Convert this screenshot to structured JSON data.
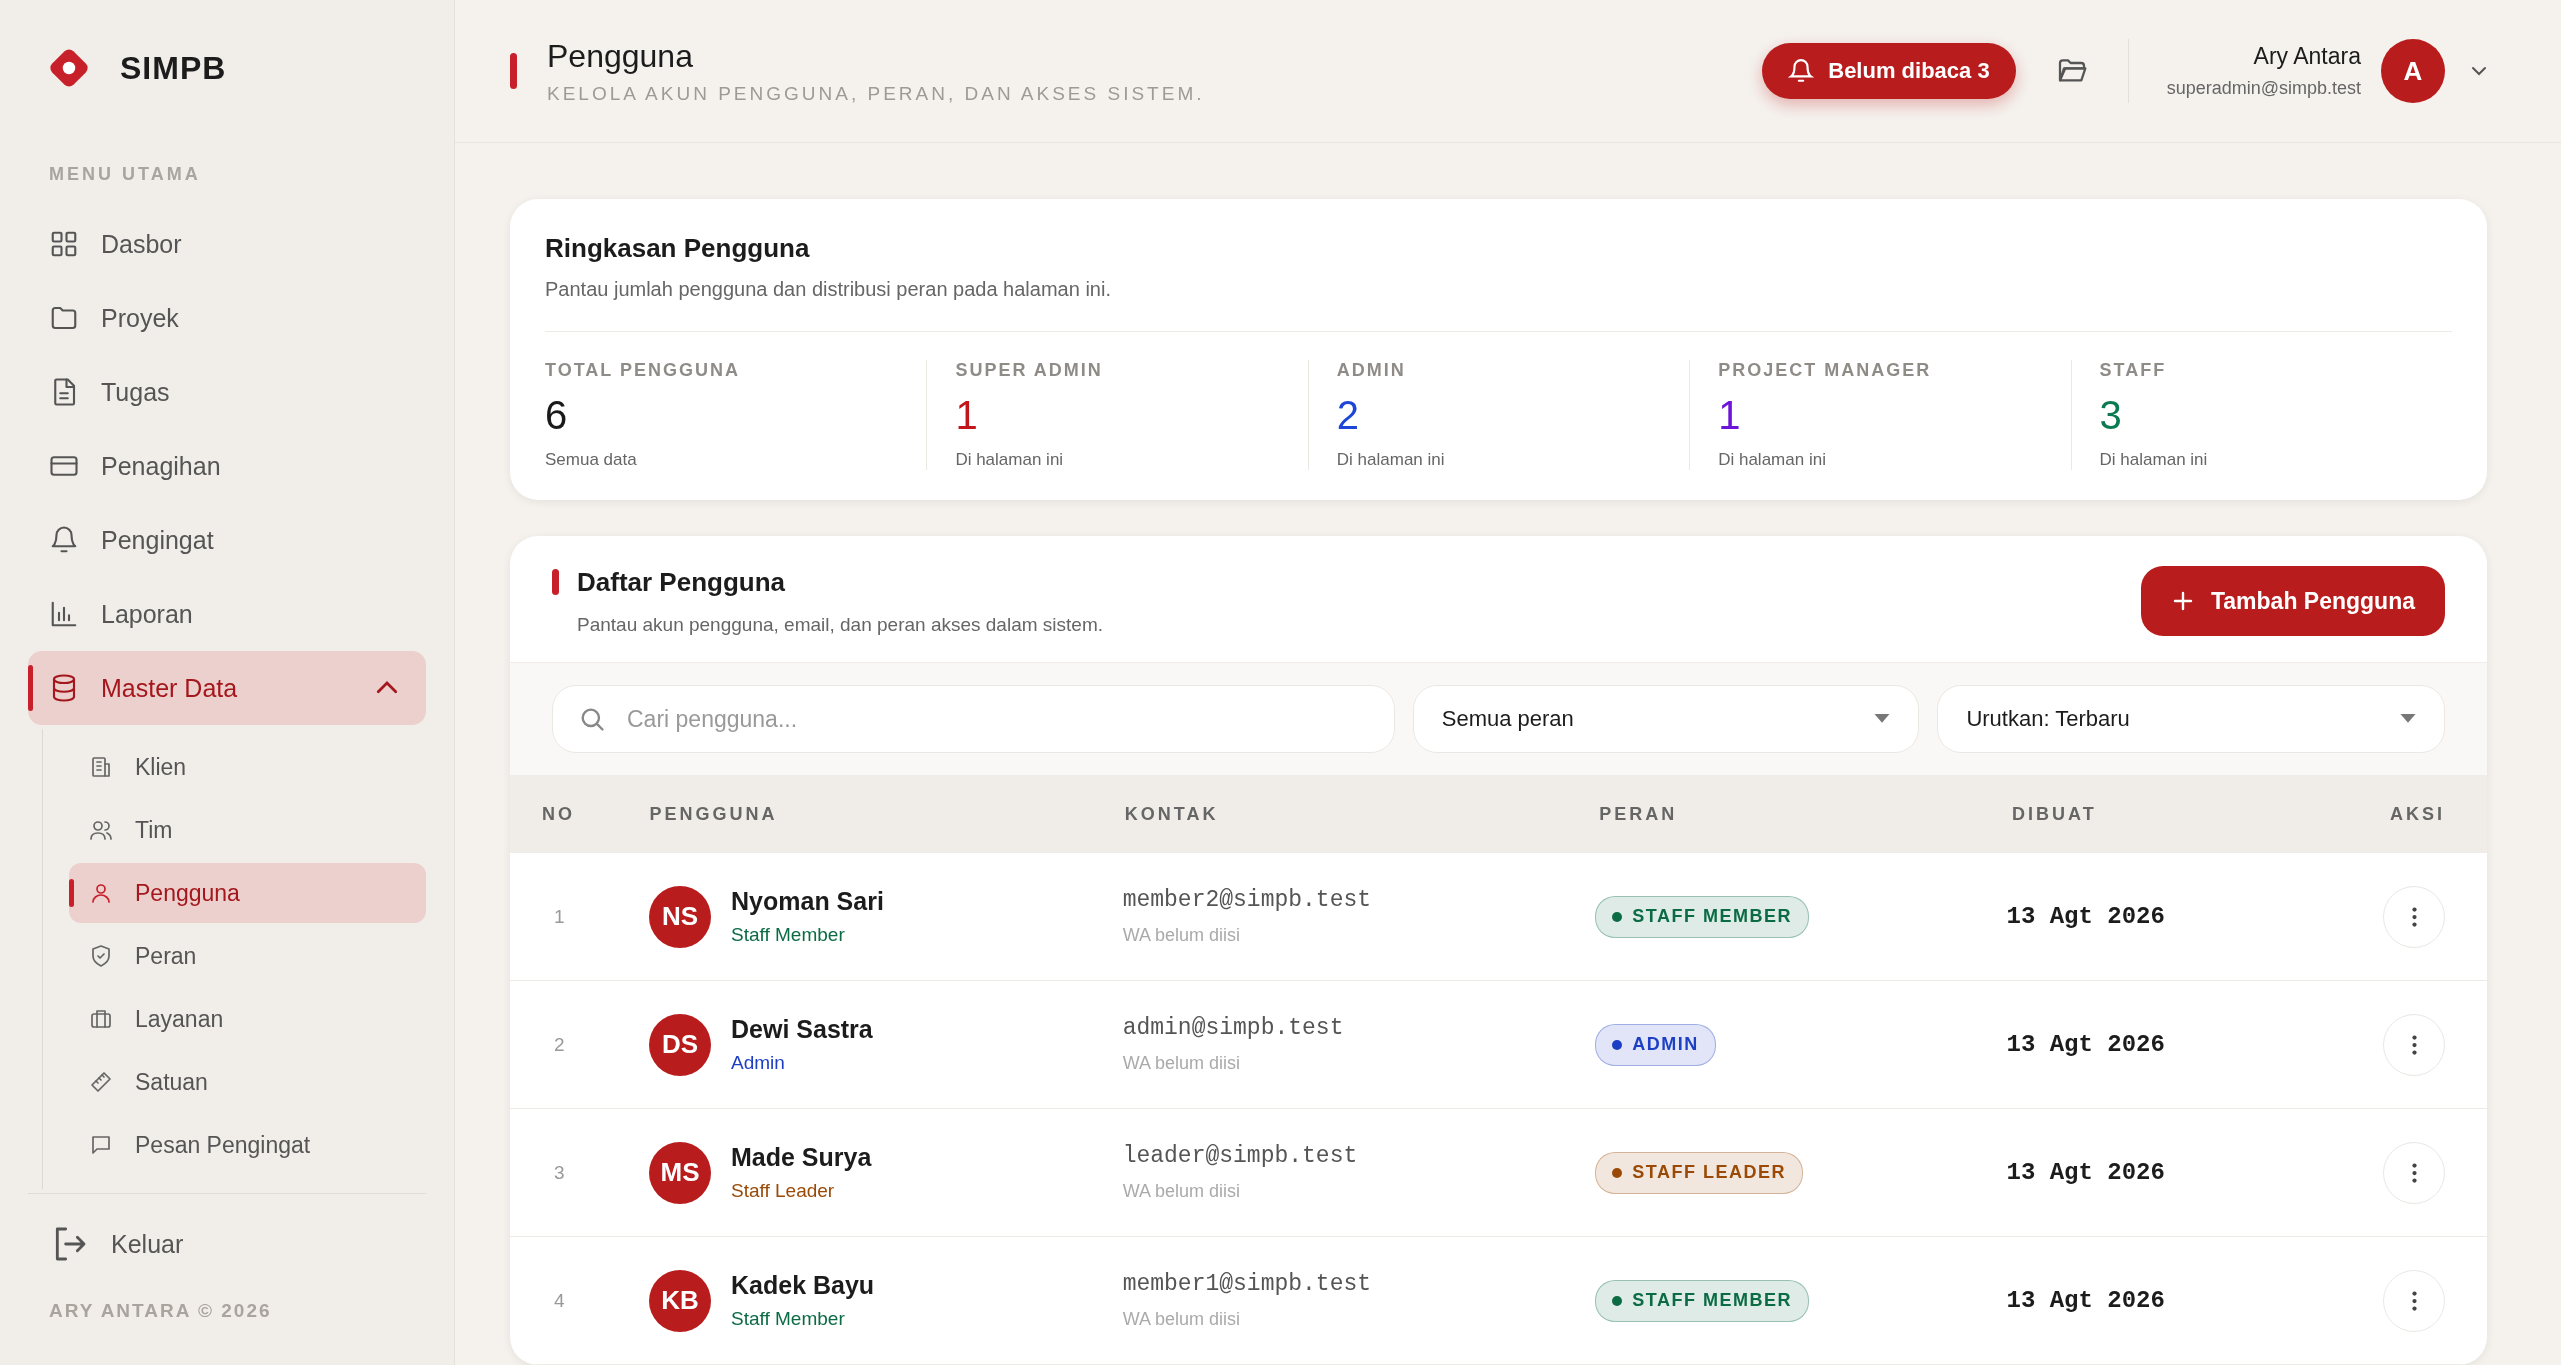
{
  "brand": {
    "name": "SIMPB"
  },
  "sidebar": {
    "section": "MENU UTAMA",
    "items": [
      {
        "label": "Dasbor",
        "selected": false
      },
      {
        "label": "Proyek",
        "selected": false
      },
      {
        "label": "Tugas",
        "selected": false
      },
      {
        "label": "Penagihan",
        "selected": false
      },
      {
        "label": "Pengingat",
        "selected": false
      },
      {
        "label": "Laporan",
        "selected": false
      },
      {
        "label": "Master Data",
        "selected": true,
        "expanded": true,
        "children": [
          {
            "label": "Klien",
            "selected": false
          },
          {
            "label": "Tim",
            "selected": false
          },
          {
            "label": "Pengguna",
            "selected": true
          },
          {
            "label": "Peran",
            "selected": false
          },
          {
            "label": "Layanan",
            "selected": false
          },
          {
            "label": "Satuan",
            "selected": false
          },
          {
            "label": "Pesan Pengingat",
            "selected": false
          }
        ]
      }
    ],
    "logout": "Keluar",
    "footer": "ARY ANTARA © 2026"
  },
  "header": {
    "title": "Pengguna",
    "subtitle": "KELOLA AKUN PENGGUNA, PERAN, DAN AKSES SISTEM.",
    "notification": "Belum dibaca 3",
    "user_name": "Ary Antara",
    "user_email": "superadmin@simpb.test",
    "avatar": "A"
  },
  "summary": {
    "title": "Ringkasan Pengguna",
    "description": "Pantau jumlah pengguna dan distribusi peran pada halaman ini.",
    "stats": [
      {
        "label": "TOTAL PENGGUNA",
        "value": "6",
        "note": "Semua data",
        "color": "#1a1a1a"
      },
      {
        "label": "SUPER ADMIN",
        "value": "1",
        "note": "Di halaman ini",
        "color": "#c0161c"
      },
      {
        "label": "ADMIN",
        "value": "2",
        "note": "Di halaman ini",
        "color": "#1d45d8"
      },
      {
        "label": "PROJECT MANAGER",
        "value": "1",
        "note": "Di halaman ini",
        "color": "#6d14d9"
      },
      {
        "label": "STAFF",
        "value": "3",
        "note": "Di halaman ini",
        "color": "#0b7a50"
      }
    ]
  },
  "user_list": {
    "title": "Daftar Pengguna",
    "description": "Pantau akun pengguna, email, dan peran akses dalam sistem.",
    "add_button": "Tambah Pengguna",
    "search": {
      "placeholder": "Cari pengguna..."
    },
    "role_filter": "Semua peran",
    "sort": "Urutkan: Terbaru",
    "columns": [
      "NO",
      "PENGGUNA",
      "KONTAK",
      "PERAN",
      "DIBUAT",
      "AKSI"
    ],
    "rows": [
      {
        "no": "1",
        "initials": "NS",
        "name": "Nyoman Sari",
        "role": "Staff Member",
        "email": "member2@simpb.test",
        "phone": "WA belum diisi",
        "badge": "STAFF MEMBER",
        "color": "#0b6b45",
        "created": "13 Agt 2026"
      },
      {
        "no": "2",
        "initials": "DS",
        "name": "Dewi Sastra",
        "role": "Admin",
        "email": "admin@simpb.test",
        "phone": "WA belum diisi",
        "badge": "ADMIN",
        "color": "#1d3fc4",
        "created": "13 Agt 2026"
      },
      {
        "no": "3",
        "initials": "MS",
        "name": "Made Surya",
        "role": "Staff Leader",
        "email": "leader@simpb.test",
        "phone": "WA belum diisi",
        "badge": "STAFF LEADER",
        "color": "#9a4a06",
        "created": "13 Agt 2026"
      },
      {
        "no": "4",
        "initials": "KB",
        "name": "Kadek Bayu",
        "role": "Staff Member",
        "email": "member1@simpb.test",
        "phone": "WA belum diisi",
        "badge": "STAFF MEMBER",
        "color": "#0b6b45",
        "created": "13 Agt 2026"
      }
    ]
  }
}
